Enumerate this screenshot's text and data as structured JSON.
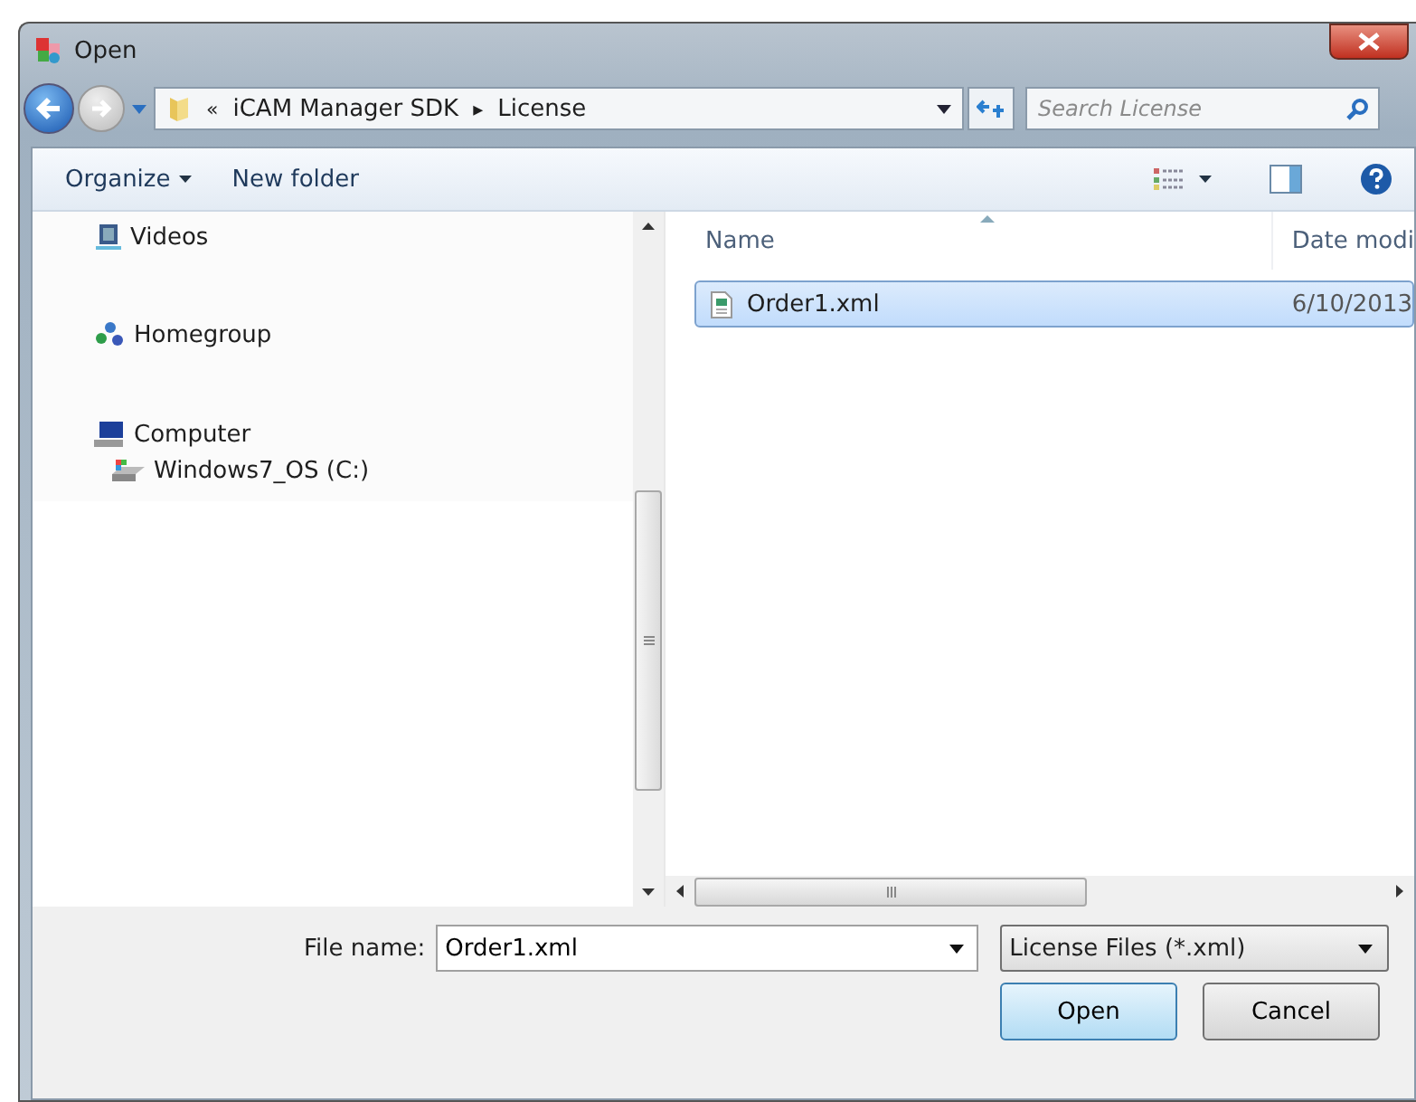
{
  "window": {
    "title": "Open"
  },
  "address_bar": {
    "overflow": "«",
    "path": [
      "iCAM Manager SDK",
      "License"
    ],
    "separator": "▸"
  },
  "search": {
    "placeholder": "Search License"
  },
  "toolbar": {
    "items": [
      "Organize",
      "New folder"
    ]
  },
  "sidebar": {
    "items": [
      {
        "label": "Videos",
        "kind": "videos"
      },
      {
        "label": "Homegroup",
        "kind": "homegroup"
      },
      {
        "label": "Computer",
        "kind": "computer",
        "children": [
          {
            "label": "Windows7_OS (C:)",
            "kind": "drive"
          }
        ]
      }
    ]
  },
  "file_list": {
    "columns": [
      "Name",
      "Date modi"
    ],
    "rows": [
      {
        "cells": [
          "Order1.xml",
          "6/10/2013"
        ],
        "selected": true
      }
    ]
  },
  "file_name": {
    "label": "File name:",
    "value": "Order1.xml"
  },
  "file_type": {
    "value": "License Files (*.xml)"
  },
  "buttons": [
    {
      "label": "Open",
      "kind": "primary"
    },
    {
      "label": "Cancel",
      "kind": "normal"
    }
  ]
}
